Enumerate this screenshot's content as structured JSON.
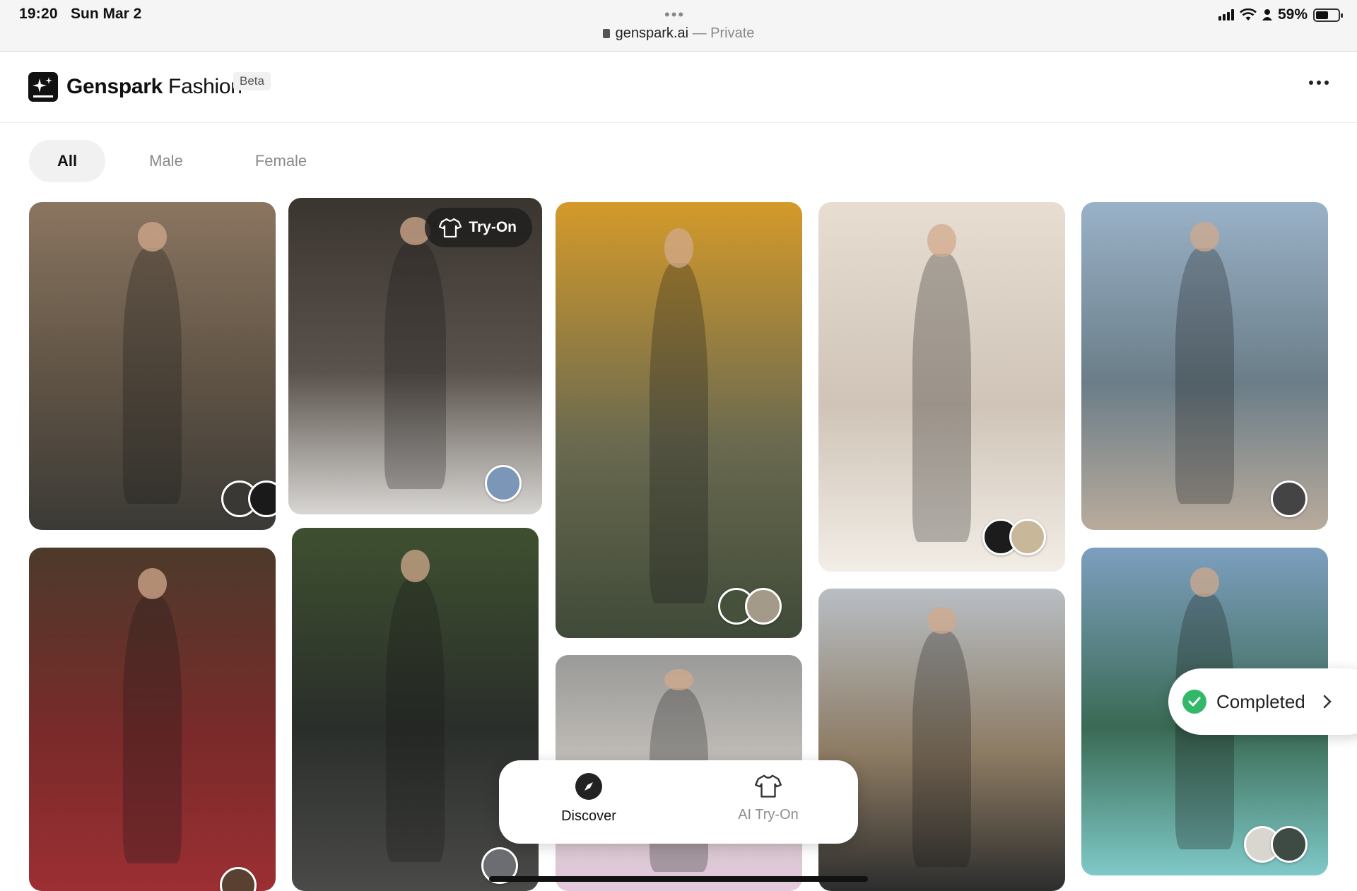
{
  "status_bar": {
    "time": "19:20",
    "date": "Sun Mar 2",
    "url": "genspark.ai",
    "private_label": "— Private",
    "battery": "59%"
  },
  "header": {
    "brand_bold": "Genspark",
    "brand_light": "Fashion",
    "beta": "Beta"
  },
  "tabs": [
    {
      "label": "All",
      "active": true
    },
    {
      "label": "Male",
      "active": false
    },
    {
      "label": "Female",
      "active": false
    }
  ],
  "try_on_label": "Try-On",
  "cards": [
    {
      "desc": "man-black-vest-outfit",
      "bg": [
        "#8a7560",
        "#5e5244",
        "#3b3a36"
      ]
    },
    {
      "desc": "woman-light-blue-dress",
      "bg": [
        "#3b3530",
        "#5a524c",
        "#d8d6d3"
      ]
    },
    {
      "desc": "man-camo-shirt-autumn",
      "bg": [
        "#d49a2a",
        "#6a6a50",
        "#3f4a38"
      ]
    },
    {
      "desc": "man-black-puffer-runway",
      "bg": [
        "#e7ddd1",
        "#cfc4b7",
        "#f2ede6"
      ]
    },
    {
      "desc": "woman-city-rooftop",
      "bg": [
        "#9ab2c8",
        "#6a7d88",
        "#b9ab9c"
      ]
    },
    {
      "desc": "woman-brown-dress-runway",
      "bg": [
        "#4d3a2b",
        "#7a2a2a",
        "#9c2f33"
      ]
    },
    {
      "desc": "man-grey-suit",
      "bg": [
        "#3e5030",
        "#2a2e2a",
        "#4a4a48"
      ]
    },
    {
      "desc": "woman-sunglasses-pink",
      "bg": [
        "#9a9a98",
        "#c9c4bf",
        "#e4c9dd"
      ]
    },
    {
      "desc": "man-tan-hoodie",
      "bg": [
        "#b8bec4",
        "#8c7a62",
        "#2d2d2d"
      ]
    },
    {
      "desc": "woman-boat-lagoon",
      "bg": [
        "#7d9fbf",
        "#3a6a54",
        "#7fc9c8"
      ]
    }
  ],
  "nav": {
    "discover": "Discover",
    "try_on": "AI Try-On"
  },
  "toast": {
    "label": "Completed"
  }
}
